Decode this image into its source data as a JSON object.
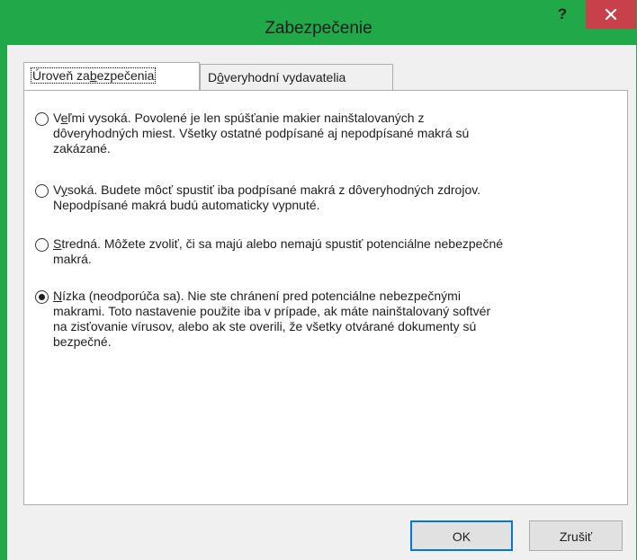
{
  "window": {
    "title": "Zabezpečenie",
    "help_label": "?",
    "accent_color": "#21a849",
    "close_color": "#c7404a"
  },
  "tabs": [
    {
      "label": "Úroveň zabezpečenia",
      "prefix": "Úroveň za",
      "accel": "b",
      "suffix": "ezpečenia",
      "active": true
    },
    {
      "label": "Dôveryhodní vydavatelia",
      "prefix": "D",
      "accel": "ô",
      "suffix": "veryhodní vydavatelia",
      "active": false
    }
  ],
  "options": [
    {
      "accel": "e",
      "first_line_prefix": "V",
      "first_line_rest": "ľmi vysoká. Povolené je len spúšťanie makier nainštalovaných z",
      "rest_lines": [
        "dôveryhodných miest. Všetky ostatné podpísané aj nepodpísané makrá sú",
        "zakázané."
      ],
      "selected": false
    },
    {
      "accel": "y",
      "first_line_prefix": "V",
      "first_line_rest": "soká. Budete môcť spustiť iba podpísané makrá z dôveryhodných zdrojov.",
      "rest_lines": [
        "Nepodpísané makrá budú automaticky vypnuté."
      ],
      "selected": false
    },
    {
      "accel": "S",
      "first_line_prefix": "",
      "first_line_rest": "tredná. Môžete zvoliť, či sa majú alebo nemajú spustiť potenciálne nebezpečné",
      "rest_lines": [
        "makrá."
      ],
      "selected": false
    },
    {
      "accel": "N",
      "first_line_prefix": "",
      "first_line_rest": "ízka (neodporúča sa). Nie ste chránení pred potenciálne nebezpečnými",
      "rest_lines": [
        "makrami. Toto nastavenie použite iba v prípade, ak máte nainštalovaný softvér",
        "na zisťovanie vírusov, alebo ak ste overili, že všetky otvárané dokumenty sú",
        "bezpečné."
      ],
      "selected": true
    }
  ],
  "buttons": {
    "ok_label": "OK",
    "cancel_label": "Zrušiť"
  }
}
